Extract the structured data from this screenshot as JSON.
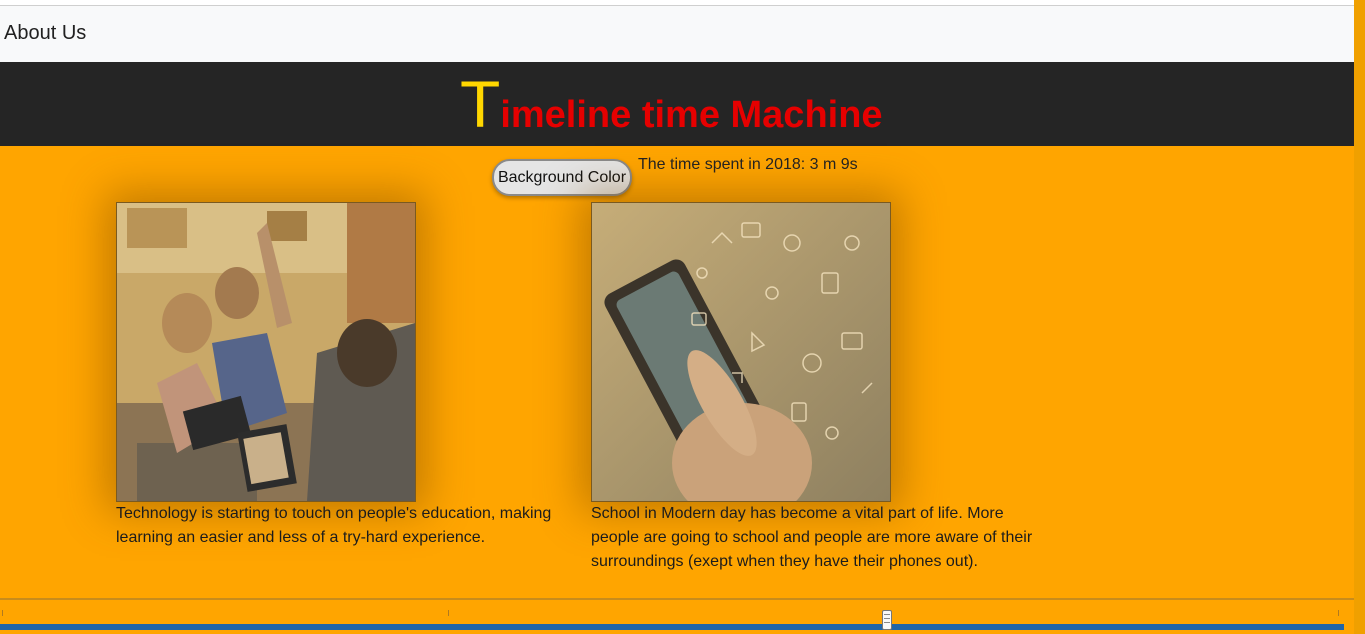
{
  "nav": {
    "about_label": "About Us"
  },
  "banner": {
    "first_letter": "T",
    "rest": "imeline time Machine"
  },
  "controls": {
    "bg_button_label": "Background Color",
    "time_text": "The time spent in 2018: 3 m 9s"
  },
  "cards": [
    {
      "image": "classroom-photo",
      "caption": "Technology is starting to touch on people's education, making learning an easier and less of a try-hard experience."
    },
    {
      "image": "smartphone-photo",
      "caption": "School in Modern day has become a vital part of life. More people are going to school and people are more aware of their surroundings (exept when they have their phones out)."
    }
  ],
  "timeline": {
    "position_fraction": 0.66
  },
  "colors": {
    "page_bg": "#ffa500",
    "banner_bg": "#252525",
    "title_letter": "#ffd700",
    "title_text": "#e60000",
    "track": "#2065a8"
  }
}
